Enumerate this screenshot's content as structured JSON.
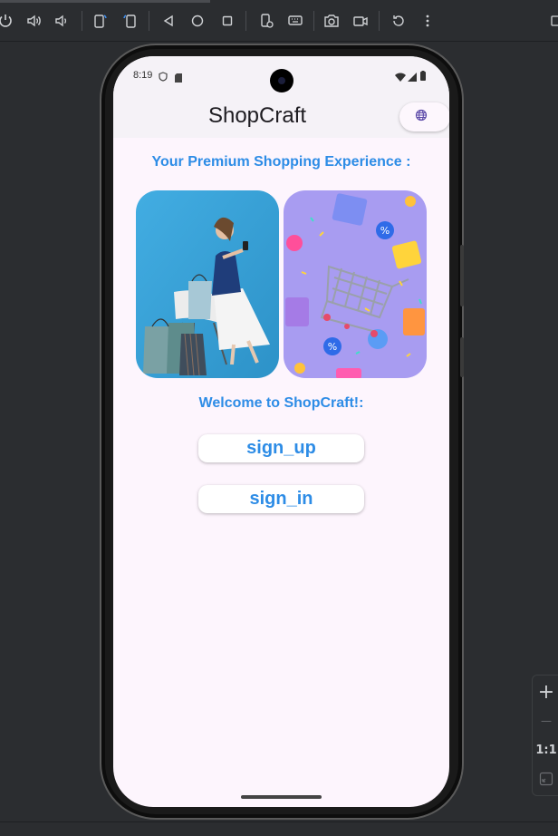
{
  "emulator": {
    "toolbar_icons": [
      "power-icon",
      "volume-up-icon",
      "volume-down-icon",
      "rotate-left-icon",
      "rotate-right-icon",
      "back-icon",
      "home-icon",
      "overview-icon",
      "device-settings-icon",
      "keyboard-icon",
      "camera-icon",
      "video-icon",
      "reset-icon",
      "more-icon"
    ],
    "zoom": {
      "zoom_in": "+",
      "zoom_out": "—",
      "ratio": "1:1"
    }
  },
  "status_bar": {
    "time": "8:19"
  },
  "app_bar": {
    "title": "ShopCraft",
    "language_icon": "globe-icon"
  },
  "main": {
    "headline": "Your Premium Shopping Experience :",
    "images": [
      "woman-with-shopping-bags-photo",
      "shopping-cart-3d-illustration"
    ],
    "welcome": "Welcome to ShopCraft!:",
    "sign_up_label": "sign_up",
    "sign_in_label": "sign_in"
  },
  "colors": {
    "accent": "#2d8ce6",
    "background": "#fdf5fd",
    "app_bar": "#f5f2f7",
    "photo_bg": "#39a6dc",
    "illustration_bg": "#a79bf0"
  }
}
